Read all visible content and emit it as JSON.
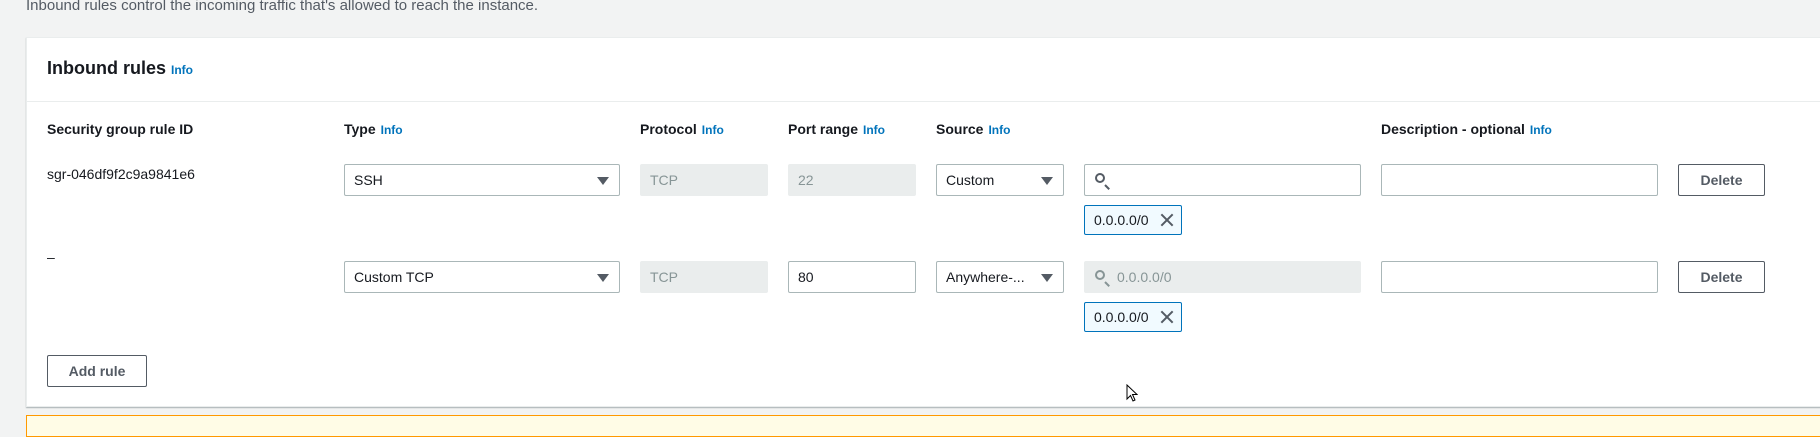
{
  "intro_text": "Inbound rules control the incoming traffic that's allowed to reach the instance.",
  "panel": {
    "title": "Inbound rules",
    "info_label": "Info"
  },
  "columns": {
    "rule_id": "Security group rule ID",
    "type": "Type",
    "protocol": "Protocol",
    "port_range": "Port range",
    "source": "Source",
    "description": "Description - optional",
    "info_label": "Info"
  },
  "rules": [
    {
      "rule_id": "sgr-046df9f2c9a9841e6",
      "type": "SSH",
      "protocol": "TCP",
      "port_range": "22",
      "source_type": "Custom",
      "source_search_placeholder": "",
      "source_token": "0.0.0.0/0",
      "description": "",
      "delete_label": "Delete"
    },
    {
      "rule_id": "–",
      "type": "Custom TCP",
      "protocol": "TCP",
      "port_range": "80",
      "source_type": "Anywhere-...",
      "source_search_placeholder": "0.0.0.0/0",
      "source_token": "0.0.0.0/0",
      "description": "",
      "delete_label": "Delete"
    }
  ],
  "add_rule_label": "Add rule",
  "colors": {
    "info_link": "#0073bb",
    "token_border": "#0073bb",
    "warning_border": "#ff9900"
  }
}
